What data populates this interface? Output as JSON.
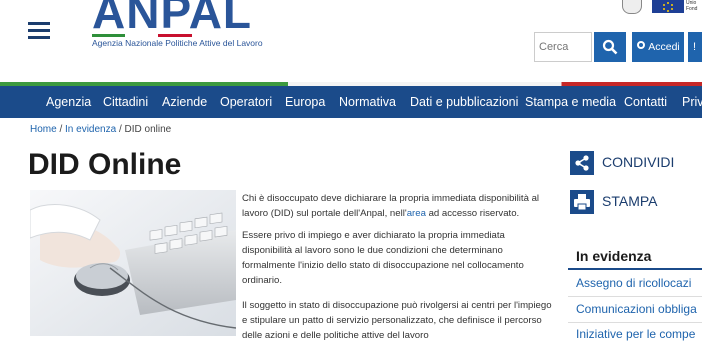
{
  "header": {
    "logo_word": "ANPAL",
    "logo_subtitle": "Agenzia Nazionale Politiche Attive del Lavoro",
    "eu_text": "Unio\nFond",
    "search_placeholder": "Cerca",
    "login_label": "Accedi",
    "extra_label": "!"
  },
  "nav": {
    "items": [
      "Agenzia",
      "Cittadini",
      "Aziende",
      "Operatori",
      "Europa",
      "Normativa",
      "Dati e pubblicazioni",
      "Stampa e media",
      "Contatti",
      "Priv"
    ]
  },
  "breadcrumb": {
    "home": "Home",
    "sep": " / ",
    "section": "In evidenza",
    "current": "DID online"
  },
  "article": {
    "title": "DID Online",
    "p1_before": "Chi è disoccupato deve dichiarare la propria immediata disponibilità al lavoro (DID) sul portale dell'Anpal, nell'",
    "p1_link": "area",
    "p1_after": " ad accesso riservato.",
    "p2": "Essere privo di impiego e aver dichiarato la propria immediata disponibilità al lavoro sono le due condizioni che determinano formalmente l'inizio dello stato di disoccupazione nel collocamento ordinario.",
    "p3": "Il soggetto in stato di disoccupazione può rivolgersi ai centri per l'impiego e stipulare un patto di servizio personalizzato, che definisce il percorso delle azioni e delle politiche attive del lavoro"
  },
  "sidebar": {
    "share_label": "CONDIVIDI",
    "print_label": "STAMPA",
    "evidence_title": "In evidenza",
    "evidence_items": [
      "Assegno di ricollocazi",
      "Comunicazioni obbliga",
      "Iniziative per le compe"
    ]
  },
  "colors": {
    "nav_bg": "#1b4b8a",
    "accent": "#1f64ad",
    "brand": "#2a5599"
  }
}
